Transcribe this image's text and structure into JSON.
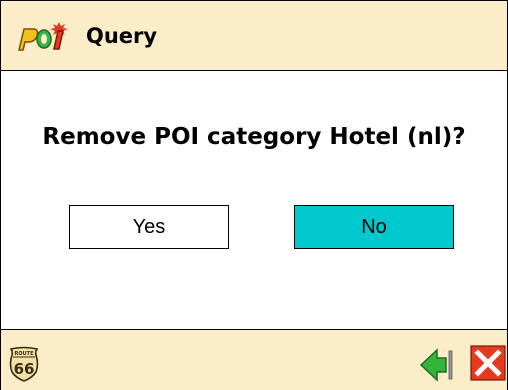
{
  "header": {
    "title": "Query",
    "logo_icon": "poi-logo-icon"
  },
  "dialog": {
    "question": "Remove POI category Hotel (nl)?",
    "yes_label": "Yes",
    "no_label": "No"
  },
  "footer": {
    "route_badge_top": "ROUTE",
    "route_badge_number": "66",
    "back_icon": "back-arrow-icon",
    "close_icon": "close-icon"
  },
  "colors": {
    "bar_background": "#fbedc8",
    "selected_button": "#00c8cc",
    "close_red": "#e53a1f",
    "back_green": "#33b53a"
  }
}
